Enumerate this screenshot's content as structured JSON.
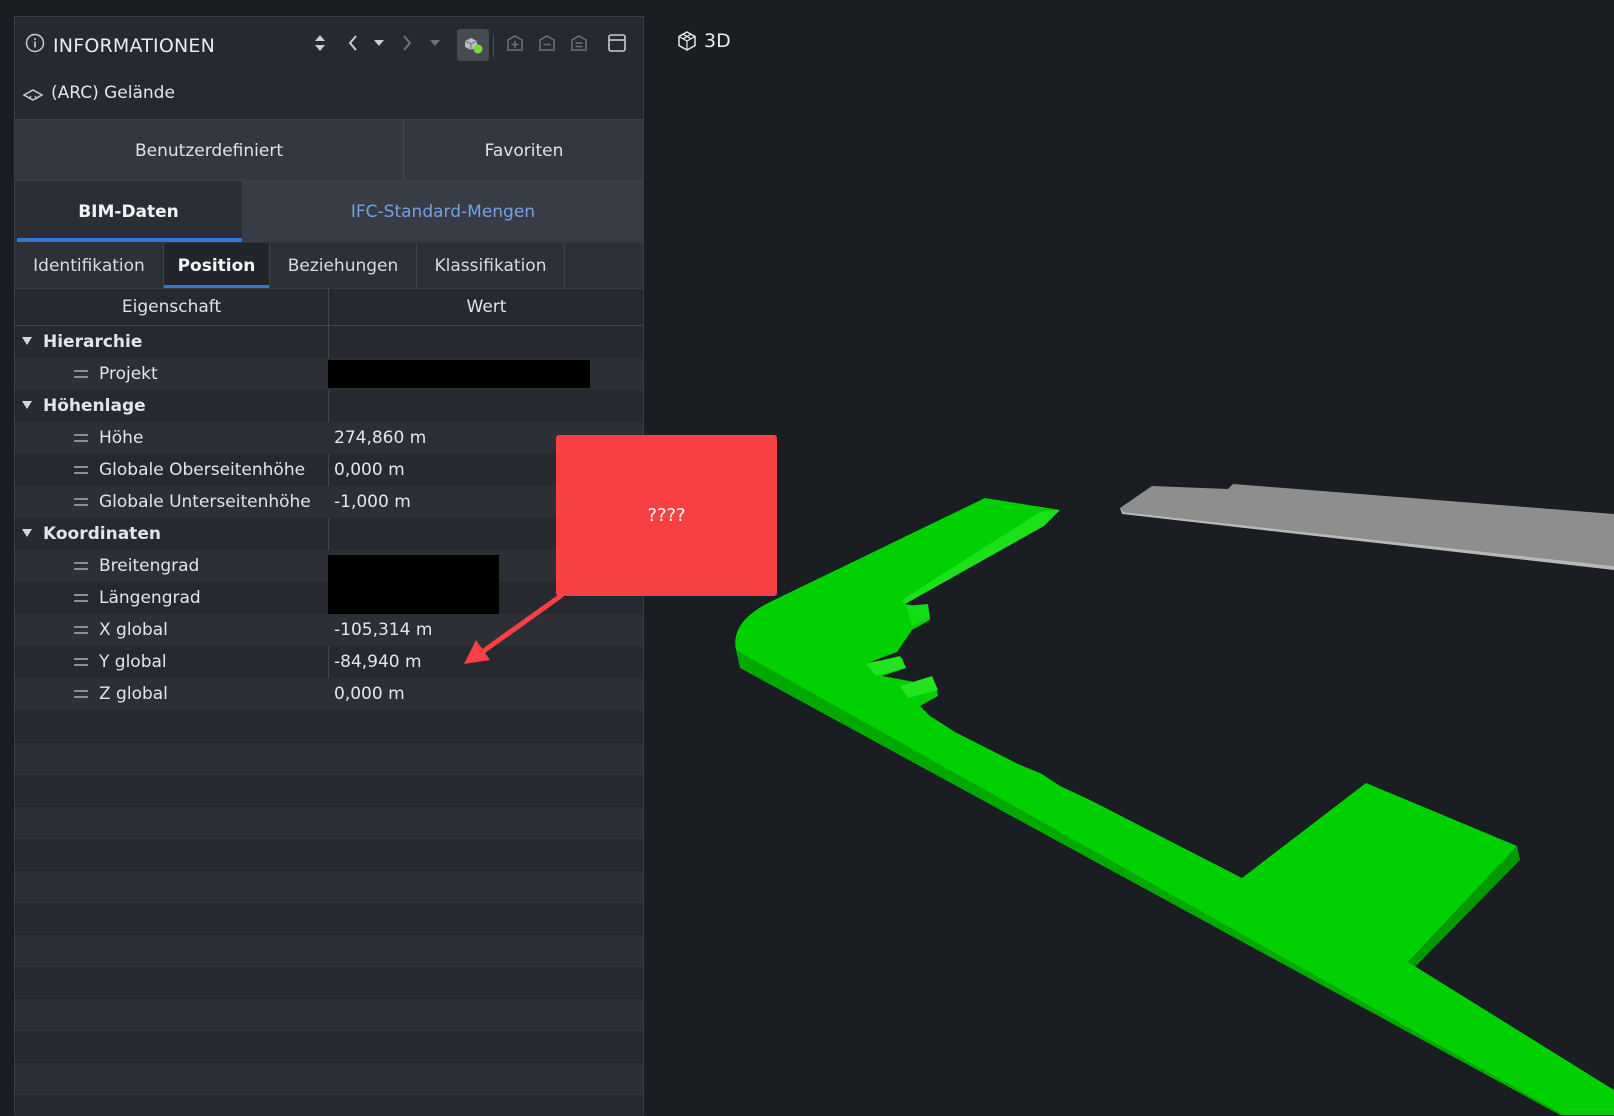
{
  "panel": {
    "title": "INFORMATIONEN",
    "element_name": "(ARC) Gelände"
  },
  "tabs_primary": [
    "Benutzerdefiniert",
    "Favoriten"
  ],
  "tabs_secondary": {
    "active": "BIM-Daten",
    "other": "IFC-Standard-Mengen"
  },
  "tabs_tertiary": [
    "Identifikation",
    "Position",
    "Beziehungen",
    "Klassifikation"
  ],
  "table": {
    "col_property": "Eigenschaft",
    "col_value": "Wert",
    "groups": [
      {
        "name": "Hierarchie",
        "rows": [
          {
            "prop": "Projekt",
            "value": ""
          }
        ]
      },
      {
        "name": "Höhenlage",
        "rows": [
          {
            "prop": "Höhe",
            "value": "274,860 m"
          },
          {
            "prop": "Globale Oberseitenhöhe",
            "value": "0,000 m"
          },
          {
            "prop": "Globale Unterseitenhöhe",
            "value": "-1,000 m"
          }
        ]
      },
      {
        "name": "Koordinaten",
        "rows": [
          {
            "prop": "Breitengrad",
            "value": ""
          },
          {
            "prop": "Längengrad",
            "value": ""
          },
          {
            "prop": "X global",
            "value": "-105,314 m"
          },
          {
            "prop": "Y global",
            "value": "-84,940 m"
          },
          {
            "prop": "Z global",
            "value": "0,000 m"
          }
        ]
      }
    ]
  },
  "viewport": {
    "label": "3D"
  },
  "callout": {
    "text": "????"
  },
  "colors": {
    "accent": "#2e7bd6",
    "link": "#6fa3e6",
    "callout": "#f94144",
    "model_green": "#00d100",
    "model_grey": "#8c8c8c"
  }
}
